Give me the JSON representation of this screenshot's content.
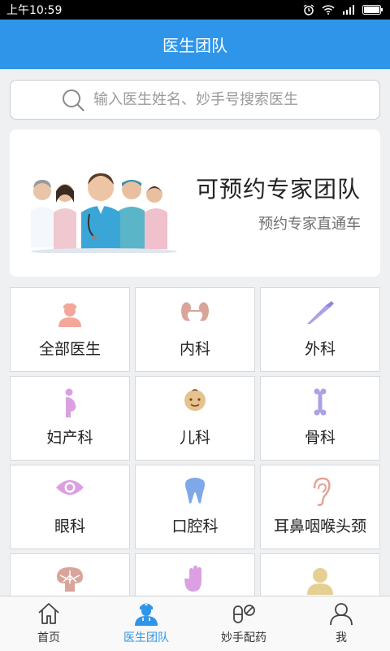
{
  "status_bar": {
    "time": "上午10:59"
  },
  "header": {
    "title": "医生团队"
  },
  "search": {
    "placeholder": "输入医生姓名、妙手号搜索医生"
  },
  "banner": {
    "title": "可预约专家团队",
    "subtitle": "预约专家直通车"
  },
  "departments": [
    {
      "label": "全部医生",
      "icon": "nurse-icon"
    },
    {
      "label": "内科",
      "icon": "kidney-icon"
    },
    {
      "label": "外科",
      "icon": "scalpel-icon"
    },
    {
      "label": "妇产科",
      "icon": "pregnant-woman-icon"
    },
    {
      "label": "儿科",
      "icon": "baby-face-icon"
    },
    {
      "label": "骨科",
      "icon": "bone-icon"
    },
    {
      "label": "眼科",
      "icon": "eye-icon"
    },
    {
      "label": "口腔科",
      "icon": "tooth-icon"
    },
    {
      "label": "耳鼻咽喉头颈",
      "icon": "ear-icon"
    },
    {
      "label": "",
      "icon": "brain-icon"
    },
    {
      "label": "",
      "icon": "hand-icon"
    },
    {
      "label": "",
      "icon": "person-icon"
    }
  ],
  "tabs": [
    {
      "label": "首页",
      "icon": "home-icon"
    },
    {
      "label": "医生团队",
      "icon": "doctor-icon",
      "active": true
    },
    {
      "label": "妙手配药",
      "icon": "pill-icon"
    },
    {
      "label": "我",
      "icon": "user-icon"
    }
  ],
  "colors": {
    "primary": "#2f95e8",
    "background": "#eef0f2"
  }
}
